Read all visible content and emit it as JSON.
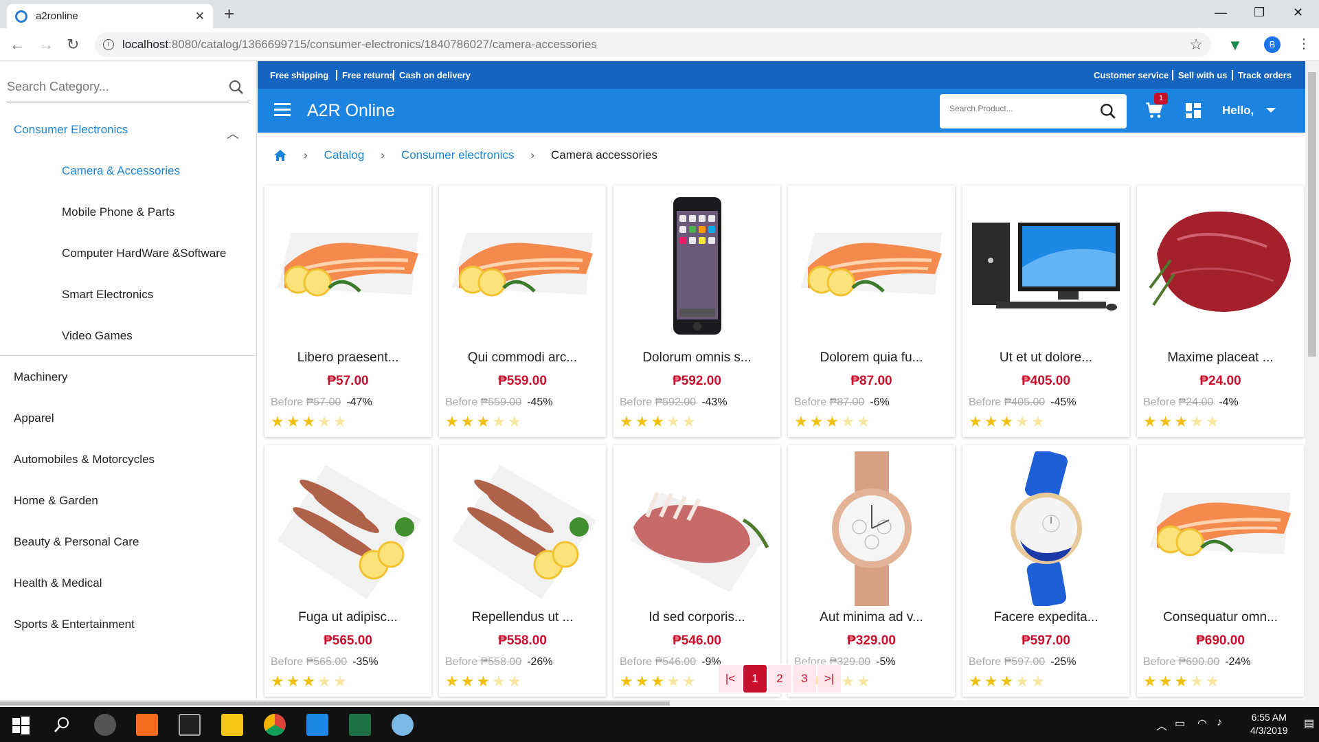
{
  "browser": {
    "tab_title": "a2ronline",
    "url_host": "localhost",
    "url_rest": ":8080/catalog/1366699715/consumer-electronics/1840786027/camera-accessories",
    "profile_initial": "B"
  },
  "sidebar": {
    "search_placeholder": "Search Category...",
    "open_category": "Consumer Electronics",
    "subcategories": [
      "Camera & Accessories",
      "Mobile Phone & Parts",
      "Computer HardWare &Software",
      "Smart Electronics",
      "Video Games"
    ],
    "categories": [
      "Machinery",
      "Apparel",
      "Automobiles & Motorcycles",
      "Home & Garden",
      "Beauty & Personal Care",
      "Health & Medical",
      "Sports & Entertainment"
    ]
  },
  "topstrip": {
    "left": [
      "Free shipping",
      "Free returns",
      "Cash on delivery"
    ],
    "right": [
      "Customer service",
      "Sell with us",
      "Track orders"
    ]
  },
  "header": {
    "brand": "A2R Online",
    "search_placeholder": "Search Product...",
    "cart_count": "1",
    "greeting": "Hello,"
  },
  "breadcrumb": {
    "items": [
      "Catalog",
      "Consumer electronics"
    ],
    "current": "Camera accessories"
  },
  "before_label": "Before",
  "products": [
    {
      "name": "Libero praesent...",
      "price": "₱57.00",
      "before": "₱57.00",
      "discount": "-47%",
      "rating": 3,
      "image": "salmon"
    },
    {
      "name": "Qui commodi arc...",
      "price": "₱559.00",
      "before": "₱559.00",
      "discount": "-45%",
      "rating": 3,
      "image": "salmon"
    },
    {
      "name": "Dolorum omnis s...",
      "price": "₱592.00",
      "before": "₱592.00",
      "discount": "-43%",
      "rating": 3,
      "image": "phone"
    },
    {
      "name": "Dolorem quia fu...",
      "price": "₱87.00",
      "before": "₱87.00",
      "discount": "-6%",
      "rating": 3,
      "image": "salmon"
    },
    {
      "name": "Ut et ut dolore...",
      "price": "₱405.00",
      "before": "₱405.00",
      "discount": "-45%",
      "rating": 3,
      "image": "computer"
    },
    {
      "name": "Maxime placeat ...",
      "price": "₱24.00",
      "before": "₱24.00",
      "discount": "-4%",
      "rating": 3,
      "image": "beef"
    },
    {
      "name": "Fuga ut adipisc...",
      "price": "₱565.00",
      "before": "₱565.00",
      "discount": "-35%",
      "rating": 3,
      "image": "shrimp"
    },
    {
      "name": "Repellendus ut ...",
      "price": "₱558.00",
      "before": "₱558.00",
      "discount": "-26%",
      "rating": 3,
      "image": "shrimp"
    },
    {
      "name": "Id sed corporis...",
      "price": "₱546.00",
      "before": "₱546.00",
      "discount": "-9%",
      "rating": 3,
      "image": "meat"
    },
    {
      "name": "Aut minima ad v...",
      "price": "₱329.00",
      "before": "₱329.00",
      "discount": "-5%",
      "rating": 3,
      "image": "watch-gold"
    },
    {
      "name": "Facere expedita...",
      "price": "₱597.00",
      "before": "₱597.00",
      "discount": "-25%",
      "rating": 3,
      "image": "watch-blue"
    },
    {
      "name": "Consequatur omn...",
      "price": "₱690.00",
      "before": "₱690.00",
      "discount": "-24%",
      "rating": 3,
      "image": "salmon"
    }
  ],
  "pagination": {
    "pages": [
      "1",
      "2",
      "3"
    ],
    "current": "1",
    "first_icon": "|<",
    "last_icon": ">|"
  },
  "taskbar": {
    "time": "6:55 AM",
    "date": "4/3/2019"
  },
  "colors": {
    "brand_blue": "#1b84e0",
    "strip_blue": "#1565c0",
    "price_red": "#c8102e",
    "link_blue": "#1b84d8",
    "star": "#f2c00f"
  }
}
